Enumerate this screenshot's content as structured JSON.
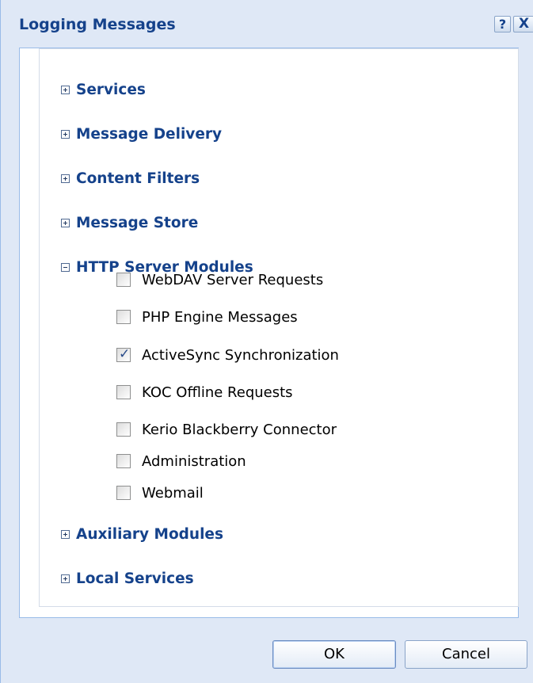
{
  "window": {
    "title": "Logging Messages",
    "help_glyph": "?",
    "close_glyph": "X"
  },
  "groups": [
    {
      "label": "Services",
      "expanded": false,
      "glyph": "+"
    },
    {
      "label": "Message Delivery",
      "expanded": false,
      "glyph": "+"
    },
    {
      "label": "Content Filters",
      "expanded": false,
      "glyph": "+"
    },
    {
      "label": "Message Store",
      "expanded": false,
      "glyph": "+"
    },
    {
      "label": "HTTP Server Modules",
      "expanded": true,
      "glyph": "-"
    },
    {
      "label": "Auxiliary Modules",
      "expanded": false,
      "glyph": "+"
    },
    {
      "label": "Local Services",
      "expanded": false,
      "glyph": "+"
    }
  ],
  "http_modules": [
    {
      "label": "WebDAV Server Requests",
      "checked": false
    },
    {
      "label": "PHP Engine Messages",
      "checked": false
    },
    {
      "label": "ActiveSync Synchronization",
      "checked": true
    },
    {
      "label": "KOC Offline Requests",
      "checked": false
    },
    {
      "label": "Kerio Blackberry Connector",
      "checked": false
    },
    {
      "label": "Administration",
      "checked": false
    },
    {
      "label": "Webmail",
      "checked": false
    }
  ],
  "check_glyph": "✓",
  "buttons": {
    "ok": "OK",
    "cancel": "Cancel"
  },
  "colors": {
    "dialog_bg": "#dfe8f6",
    "title_text": "#15428b",
    "group_text": "#15428b",
    "border": "#99bbe8"
  }
}
